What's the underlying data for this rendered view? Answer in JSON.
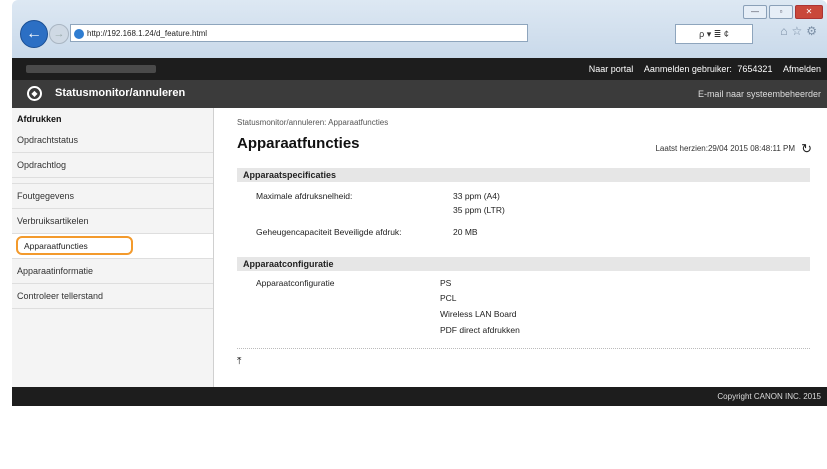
{
  "browser": {
    "address": "http://192.168.1.24/d_feature.html",
    "search_tools": "ρ ▾ ≣ ¢",
    "window_controls": [
      "—",
      "▫",
      "✕"
    ]
  },
  "topbar": {
    "links": [
      "Naar portal",
      "Aanmelden gebruiker:",
      "7654321",
      "Afmelden"
    ]
  },
  "header": {
    "title": "Statusmonitor/annuleren",
    "email_link": "E-mail naar systeembeheerder"
  },
  "sidebar": {
    "heading": "Afdrukken",
    "items": [
      {
        "label": "Opdrachtstatus"
      },
      {
        "label": "Opdrachtlog"
      },
      {
        "label": "Foutgegevens"
      },
      {
        "label": "Verbruiksartikelen"
      },
      {
        "label": "Apparaatfuncties"
      },
      {
        "label": "Apparaatinformatie"
      },
      {
        "label": "Controleer tellerstand"
      }
    ]
  },
  "main": {
    "breadcrumb": "Statusmonitor/annuleren: Apparaatfuncties",
    "title": "Apparaatfuncties",
    "last_updated": "Laatst herzien:29/04 2015 08:48:11 PM",
    "section1": {
      "heading": "Apparaatspecificaties",
      "rows": [
        {
          "label": "Maximale afdruksnelheid:",
          "values": [
            "33 ppm (A4)",
            "35 ppm (LTR)"
          ]
        },
        {
          "label": "Geheugencapaciteit Beveiligde afdruk:",
          "values": [
            "20 MB"
          ]
        }
      ]
    },
    "section2": {
      "heading": "Apparaatconfiguratie",
      "rows": [
        {
          "label": "Apparaatconfiguratie",
          "values": [
            "PS",
            "PCL",
            "Wireless LAN Board",
            "PDF direct afdrukken"
          ]
        }
      ]
    }
  },
  "footer": {
    "copyright": "Copyright CANON INC. 2015"
  }
}
